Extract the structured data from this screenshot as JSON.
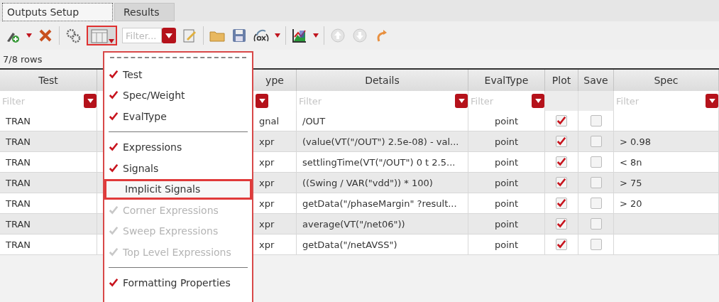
{
  "tabs": [
    {
      "label": "Outputs Setup",
      "selected": true
    },
    {
      "label": "Results",
      "selected": false
    }
  ],
  "toolbar": {
    "filter_placeholder": "Filter..."
  },
  "row_count": "7/8 rows",
  "table": {
    "columns": [
      {
        "header": "Test",
        "kind": "text",
        "filter": true,
        "filter_placeholder": "Filter"
      },
      {
        "kind": "text",
        "filter": false
      },
      {
        "header": "ype",
        "kind": "text",
        "filter": true
      },
      {
        "header": "Details",
        "kind": "text",
        "filter": true,
        "filter_placeholder": "Filter"
      },
      {
        "header": "EvalType",
        "kind": "center",
        "filter": true,
        "filter_placeholder": "Filter"
      },
      {
        "header": "Plot",
        "kind": "checkbox",
        "filter": false
      },
      {
        "header": "Save",
        "kind": "checkbox",
        "filter": false
      },
      {
        "header": "Spec",
        "kind": "text",
        "filter": true,
        "filter_placeholder": "Filter"
      }
    ],
    "rows": [
      {
        "test": "TRAN",
        "type": "gnal",
        "details": "/OUT",
        "eval_type": "point",
        "plot": true,
        "save": false
      },
      {
        "test": "TRAN",
        "type": "xpr",
        "details": "(value(VT(\"/OUT\") 2.5e-08) - val...",
        "eval_type": "point",
        "plot": true,
        "save": false,
        "spec": "> 0.98"
      },
      {
        "test": "TRAN",
        "type": "xpr",
        "details": "settlingTime(VT(\"/OUT\") 0 t 2.5...",
        "eval_type": "point",
        "plot": true,
        "save": false,
        "spec": "< 8n"
      },
      {
        "test": "TRAN",
        "type": "xpr",
        "details": "((Swing / VAR(\"vdd\")) * 100)",
        "eval_type": "point",
        "plot": true,
        "save": false,
        "spec": "> 75"
      },
      {
        "test": "TRAN",
        "type": "xpr",
        "details": "getData(\"/phaseMargin\" ?result...",
        "eval_type": "point",
        "plot": true,
        "save": false,
        "spec": "> 20"
      },
      {
        "test": "TRAN",
        "type": "xpr",
        "details": "average(VT(\"/net06\"))",
        "eval_type": "point",
        "plot": true,
        "save": false
      },
      {
        "test": "TRAN",
        "type": "xpr",
        "details": "getData(\"/netAVSS\")",
        "eval_type": "point",
        "plot": true,
        "save": false
      }
    ]
  },
  "column_menu": {
    "items": [
      {
        "kind": "item",
        "label": "Test",
        "checked": true,
        "disabled": false,
        "selected": false
      },
      {
        "kind": "item",
        "label": "Spec/Weight",
        "checked": true,
        "disabled": false,
        "selected": false
      },
      {
        "kind": "item",
        "label": "EvalType",
        "checked": true,
        "disabled": false,
        "selected": false
      },
      {
        "kind": "separator"
      },
      {
        "kind": "item",
        "label": "Expressions",
        "checked": true,
        "disabled": false,
        "selected": false
      },
      {
        "kind": "item",
        "label": "Signals",
        "checked": true,
        "disabled": false,
        "selected": false
      },
      {
        "kind": "item",
        "label": "Implicit Signals",
        "checked": false,
        "disabled": false,
        "selected": true
      },
      {
        "kind": "item",
        "label": "Corner Expressions",
        "checked": true,
        "disabled": true,
        "selected": false
      },
      {
        "kind": "item",
        "label": "Sweep Expressions",
        "checked": true,
        "disabled": true,
        "selected": false
      },
      {
        "kind": "item",
        "label": "Top Level Expressions",
        "checked": true,
        "disabled": true,
        "selected": false
      },
      {
        "kind": "separator"
      },
      {
        "kind": "item",
        "label": "Formatting Properties",
        "checked": true,
        "disabled": false,
        "selected": false
      }
    ]
  }
}
